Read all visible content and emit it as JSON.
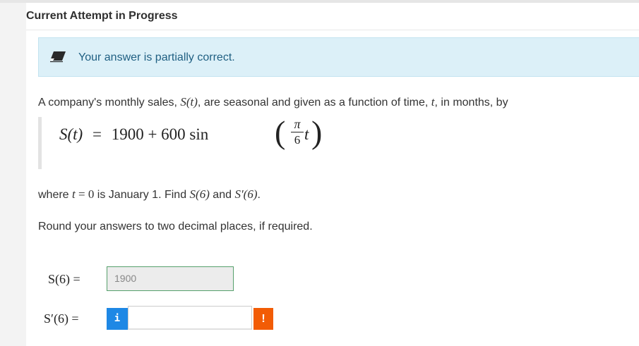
{
  "header": {
    "title": "Current Attempt in Progress"
  },
  "feedback": {
    "icon": "eraser-icon",
    "message": "Your answer is partially correct.",
    "color": "#1f5f82",
    "background": "#dcf0f8"
  },
  "question": {
    "intro_text": "A company's monthly sales, ",
    "intro_func": "S(t)",
    "intro_mid": ", are seasonal and given as a function of time, ",
    "intro_var": "t",
    "intro_end": ", in months, by",
    "formula": {
      "lhs": "S(t)",
      "eq": "=",
      "rhs": "1900 + 600 sin",
      "frac_num": "π",
      "frac_den": "6",
      "arg_var": "t"
    },
    "where_text": "where ",
    "where_var": "t",
    "where_eq": " = ",
    "where_zero": "0",
    "where_mid": " is January 1. Find ",
    "where_s6": "S(6)",
    "where_and": " and ",
    "where_sp6": "S′(6)",
    "where_end": ".",
    "round_text": "Round your answers to two decimal places, if required."
  },
  "answers": {
    "s6": {
      "label": "S(6) =",
      "value": "1900"
    },
    "sp6": {
      "label": "S′(6) =",
      "value": "",
      "info_icon": "i",
      "warning_icon": "!"
    }
  },
  "colors": {
    "correct_border": "#56a06c",
    "info": "#1e88e5",
    "warning": "#f25c05"
  }
}
